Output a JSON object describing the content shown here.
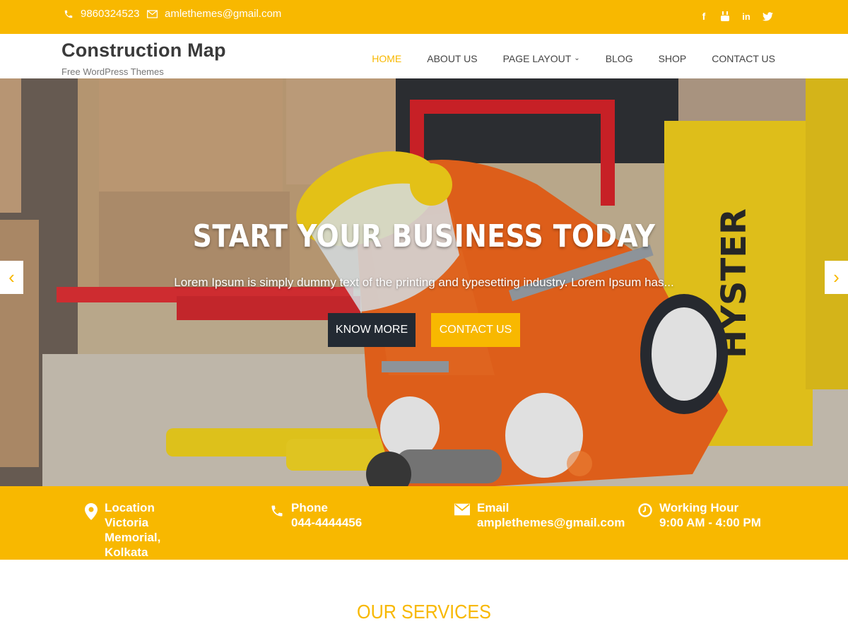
{
  "topbar": {
    "phone": "9860324523",
    "email": "amlethemes@gmail.com",
    "social": [
      "facebook-icon",
      "youtube-icon",
      "linkedin-icon",
      "twitter-icon"
    ]
  },
  "header": {
    "site_title": "Construction Map",
    "tagline": "Free WordPress Themes"
  },
  "nav": {
    "items": [
      {
        "label": "HOME",
        "active": true
      },
      {
        "label": "ABOUT US"
      },
      {
        "label": "PAGE LAYOUT",
        "has_dropdown": true
      },
      {
        "label": "BLOG"
      },
      {
        "label": "SHOP"
      },
      {
        "label": "CONTACT US"
      }
    ]
  },
  "hero": {
    "title": "START YOUR BUSINESS TODAY",
    "subtitle": "Lorem Ipsum is simply dummy text of the printing and typesetting industry. Lorem Ipsum has...",
    "btn_primary": "KNOW MORE",
    "btn_secondary": "CONTACT US",
    "prev_arrow": "‹",
    "next_arrow": "›"
  },
  "info": {
    "location": {
      "label": "Location",
      "value": "Victoria Memorial, Kolkata"
    },
    "phone": {
      "label": "Phone",
      "value": "044-4444456"
    },
    "email": {
      "label": "Email",
      "value": "amplethemes@gmail.com"
    },
    "hours": {
      "label": "Working Hour",
      "value": "9:00 AM - 4:00 PM"
    }
  },
  "services": {
    "title": "OUR SERVICES"
  },
  "colors": {
    "accent": "#f8b800",
    "dark_button": "#232a33"
  }
}
